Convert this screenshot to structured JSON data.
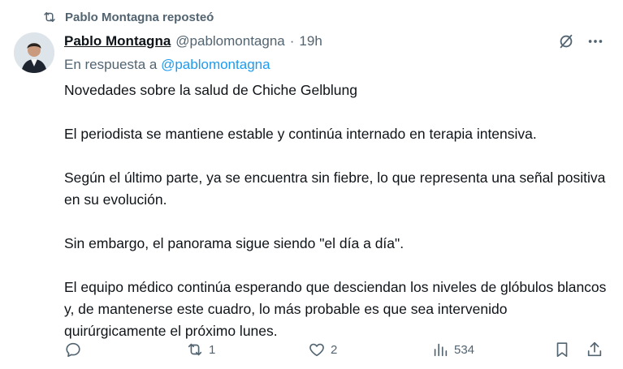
{
  "repost": {
    "text": "Pablo Montagna reposteó",
    "icon": "repost-icon"
  },
  "tweet": {
    "author_name": "Pablo Montagna",
    "handle": "@pablomontagna",
    "separator": "·",
    "time": "19h",
    "reply_prefix": "En respuesta a",
    "reply_mention": "@pablomontagna",
    "paragraphs": [
      "Novedades sobre la salud de Chiche Gelblung",
      "El periodista se mantiene estable y continúa internado en terapia intensiva.",
      "Según el último parte, ya se encuentra sin fiebre, lo que representa una señal positiva en su evolución.",
      "Sin embargo, el panorama sigue siendo \"el día a día\".",
      "El equipo médico continúa esperando que desciendan los niveles de glóbulos blancos y, de mantenerse este cuadro, lo más probable es que sea intervenido quirúrgicamente el próximo lunes."
    ]
  },
  "actions": {
    "reply": {
      "icon": "reply-icon",
      "count": ""
    },
    "repost": {
      "icon": "repost-icon",
      "count": "1"
    },
    "like": {
      "icon": "heart-icon",
      "count": "2"
    },
    "views": {
      "icon": "views-icon",
      "count": "534"
    },
    "bookmark": {
      "icon": "bookmark-icon"
    },
    "share": {
      "icon": "share-icon"
    }
  },
  "colors": {
    "secondary": "#536471",
    "link": "#1d9bf0",
    "text": "#0f1419"
  }
}
